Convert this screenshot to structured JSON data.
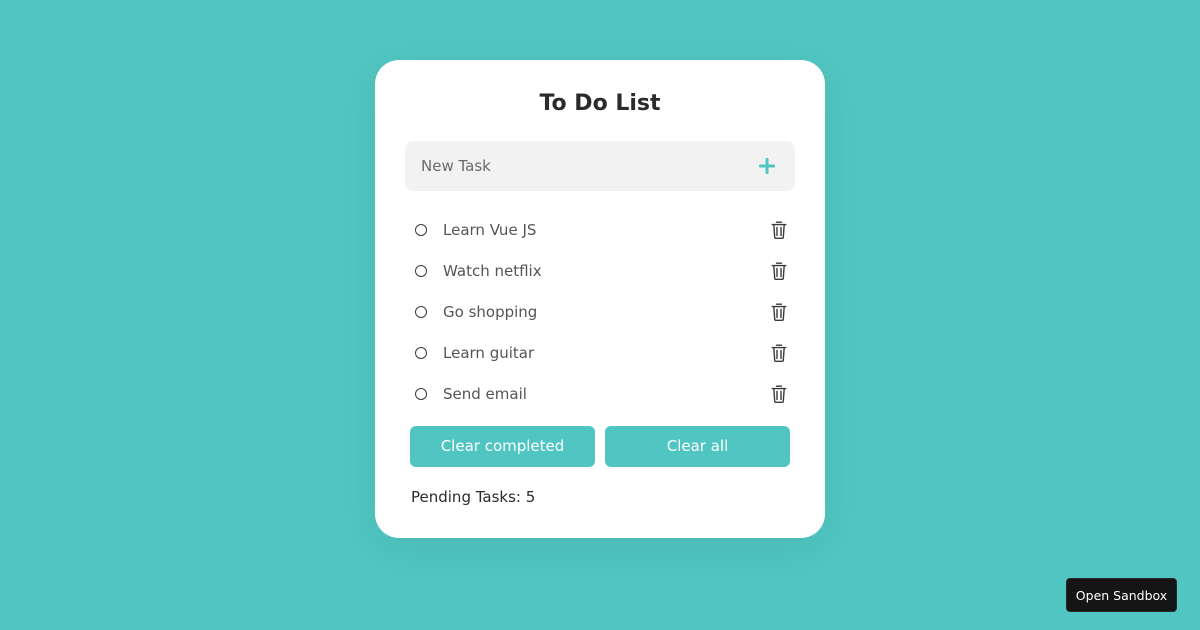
{
  "app": {
    "title": "To Do List",
    "accent_color": "#50c5c1"
  },
  "new_task": {
    "value": "",
    "placeholder": "New Task",
    "add_icon": "plus-icon"
  },
  "tasks": [
    {
      "label": "Learn Vue JS",
      "completed": false
    },
    {
      "label": "Watch netflix",
      "completed": false
    },
    {
      "label": "Go shopping",
      "completed": false
    },
    {
      "label": "Learn guitar",
      "completed": false
    },
    {
      "label": "Send email",
      "completed": false
    }
  ],
  "task_icons": {
    "status": "circle-icon",
    "delete": "trash-icon"
  },
  "actions": {
    "clear_completed": "Clear completed",
    "clear_all": "Clear all"
  },
  "footer": {
    "pending_text": "Pending Tasks: 5"
  },
  "sandbox": {
    "label": "Open Sandbox"
  }
}
